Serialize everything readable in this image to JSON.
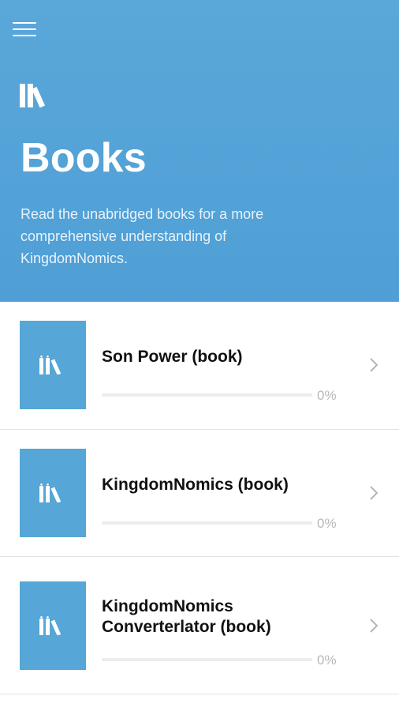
{
  "header": {
    "menu_icon": "hamburger-menu-icon",
    "logo_icon": "books-icon",
    "title": "Books",
    "description": "Read the unabridged books for a more comprehensive understanding of KingdomNomics."
  },
  "books": [
    {
      "title": "Son Power (book)",
      "progress_percent": 0,
      "progress_label": "0%",
      "cover_icon": "books-icon"
    },
    {
      "title": "KingdomNomics (book)",
      "progress_percent": 0,
      "progress_label": "0%",
      "cover_icon": "books-icon"
    },
    {
      "title": "KingdomNomics Converterlator (book)",
      "progress_percent": 0,
      "progress_label": "0%",
      "cover_icon": "books-icon"
    }
  ],
  "colors": {
    "header_background": "#4f9fd6",
    "cover_background": "#56a6d8",
    "progress_track": "#ececec",
    "progress_label": "#b8b8b8",
    "chevron": "#b5b5b5"
  }
}
